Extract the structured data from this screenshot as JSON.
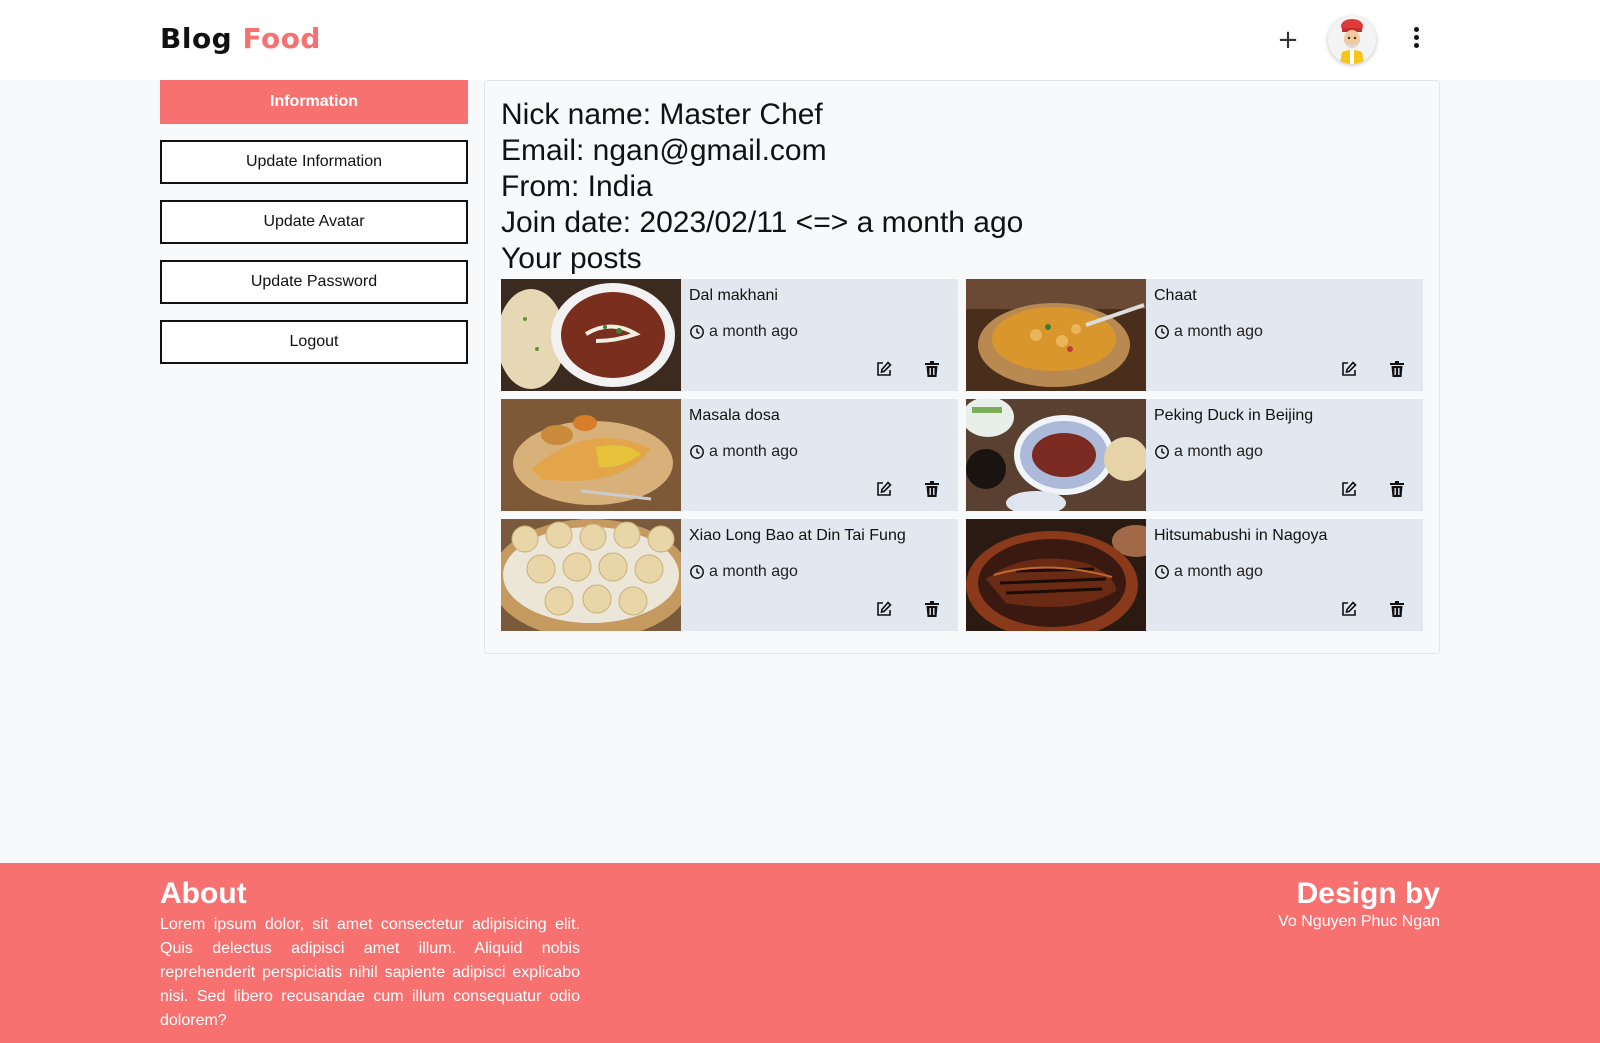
{
  "header": {
    "brand_part1": "Blog",
    "brand_part2": "Food",
    "add_label": "+",
    "menu_icon": "kebab-menu-icon"
  },
  "sidebar": {
    "items": [
      {
        "label": "Information",
        "active": true
      },
      {
        "label": "Update Information",
        "active": false
      },
      {
        "label": "Update Avatar",
        "active": false
      },
      {
        "label": "Update Password",
        "active": false
      },
      {
        "label": "Logout",
        "active": false
      }
    ]
  },
  "profile": {
    "nick_name": "Nick name: Master Chef",
    "email": "Email: ngan@gmail.com",
    "from": "From: India",
    "join_date": "Join date: 2023/02/11 <=> a month ago",
    "posts_heading": "Your posts"
  },
  "posts": [
    {
      "title": "Dal makhani",
      "time": "a month ago"
    },
    {
      "title": "Chaat",
      "time": "a month ago"
    },
    {
      "title": "Masala dosa",
      "time": "a month ago"
    },
    {
      "title": "Peking Duck in Beijing",
      "time": "a month ago"
    },
    {
      "title": "Xiao Long Bao at Din Tai Fung",
      "time": "a month ago"
    },
    {
      "title": "Hitsumabushi in Nagoya",
      "time": "a month ago"
    }
  ],
  "footer": {
    "about_heading": "About",
    "about_text": "Lorem ipsum dolor, sit amet consectetur adipisicing elit. Quis delectus adipisci amet illum. Aliquid nobis reprehenderit perspiciatis nihil sapiente adipisci explicabo nisi. Sed libero recusandae cum illum consequatur odio dolorem?",
    "design_heading": "Design by",
    "designer": "Vo Nguyen Phuc Ngan"
  },
  "colors": {
    "accent": "#f87171",
    "card_bg": "#e2e8f0",
    "page_bg": "#f8f9fb"
  },
  "icons": {
    "edit": "edit-icon",
    "delete": "trash-icon",
    "clock": "clock-icon"
  }
}
